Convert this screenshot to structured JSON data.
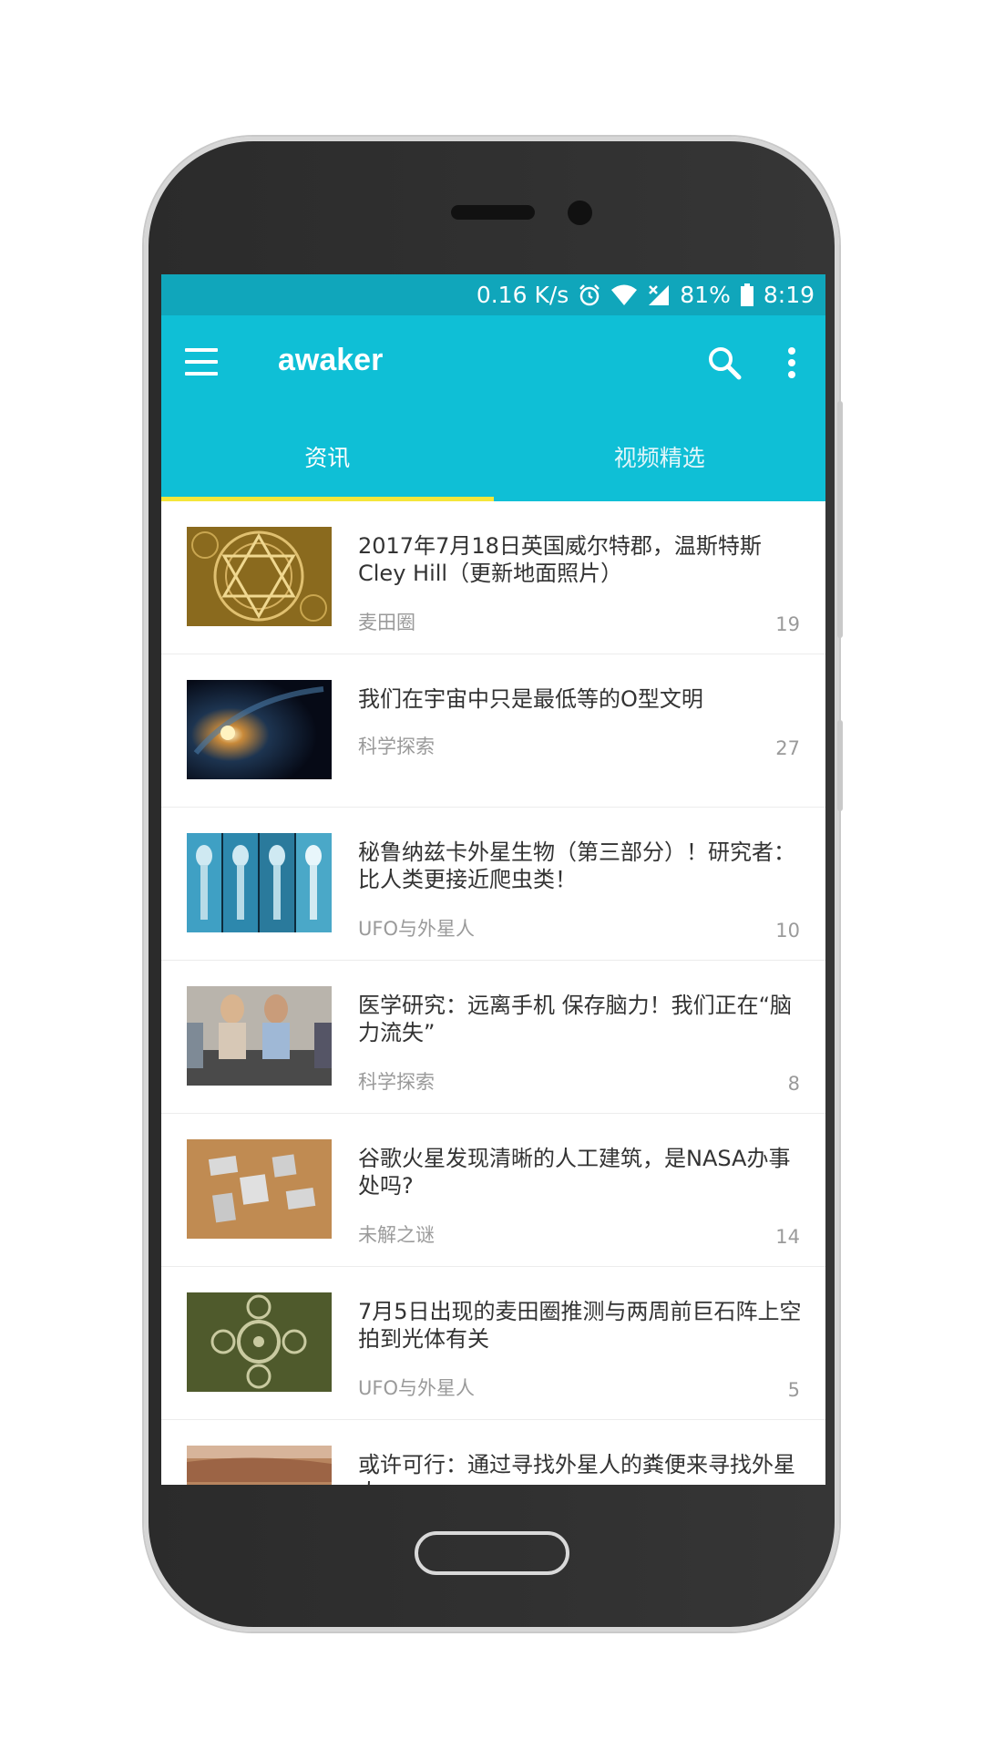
{
  "status_bar": {
    "speed": "0.16 K/s",
    "battery": "81%",
    "time": "8:19"
  },
  "app_bar": {
    "title": "awaker"
  },
  "tabs": [
    {
      "label": "资讯",
      "active": true
    },
    {
      "label": "视频精选",
      "active": false
    }
  ],
  "articles": [
    {
      "title": "2017年7月18日英国威尔特郡，温斯特斯Cley Hill（更新地面照片）",
      "category": "麦田圈",
      "count": "19",
      "thumb": "crop-circle-gold"
    },
    {
      "title": "我们在宇宙中只是最低等的O型文明",
      "category": "科学探索",
      "count": "27",
      "thumb": "galaxy"
    },
    {
      "title": "秘鲁纳兹卡外星生物（第三部分）！研究者：比人类更接近爬虫类！",
      "category": "UFO与外星人",
      "count": "10",
      "thumb": "xray-aliens"
    },
    {
      "title": "医学研究：远离手机 保存脑力！我们正在“脑力流失”",
      "category": "科学探索",
      "count": "8",
      "thumb": "people-phones"
    },
    {
      "title": "谷歌火星发现清晰的人工建筑，是NASA办事处吗?",
      "category": "未解之谜",
      "count": "14",
      "thumb": "mars-buildings"
    },
    {
      "title": "7月5日出现的麦田圈推测与两周前巨石阵上空拍到光体有关",
      "category": "UFO与外星人",
      "count": "5",
      "thumb": "crop-circle-green"
    },
    {
      "title": "或许可行：通过寻找外星人的粪便来寻找外星人",
      "category": "",
      "count": "",
      "thumb": "mars-landscape"
    }
  ],
  "colors": {
    "status_bar": "#10a6bb",
    "app_bar": "#0fbfd6",
    "tab_indicator": "#f5e63a"
  }
}
